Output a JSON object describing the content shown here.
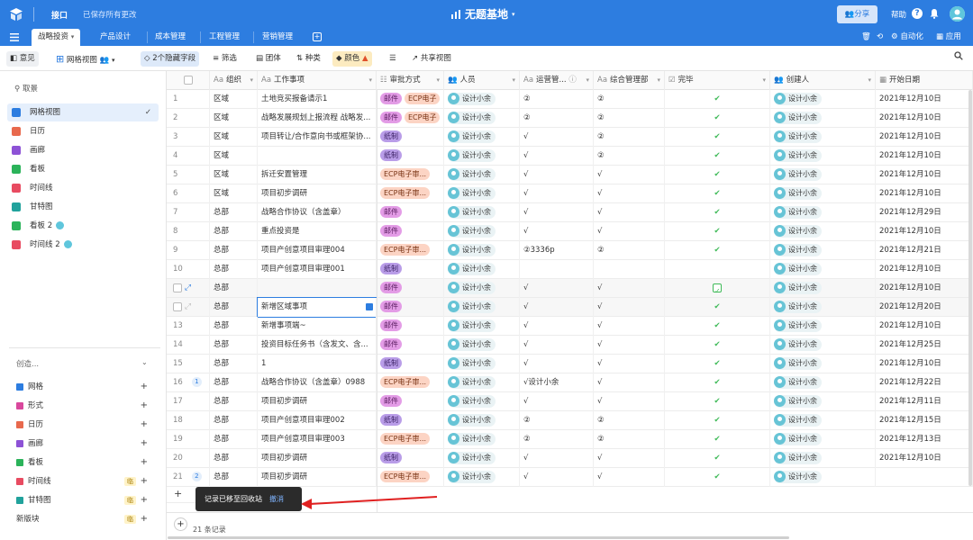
{
  "topbar": {
    "mode": "接口",
    "save_status": "已保存所有更改",
    "title": "无题基地",
    "share": "分享",
    "help": "帮助"
  },
  "tabs": [
    "战略投资",
    "产品设计",
    "成本管理",
    "工程管理",
    "营销管理"
  ],
  "tabbar_right": {
    "automation": "自动化",
    "apps": "应用"
  },
  "toolbar": {
    "opinion": "意见",
    "view": "网格视图",
    "hidden_fields": "2个隐藏字段",
    "filter": "筛选",
    "group": "团体",
    "sort": "种类",
    "color": "颜色",
    "share_view": "共享视图"
  },
  "sidebar": {
    "search": "取景",
    "views": [
      {
        "label": "网格视图",
        "color": "#2d7de0",
        "active": true
      },
      {
        "label": "日历",
        "color": "#e8694d"
      },
      {
        "label": "画廊",
        "color": "#8d52d6"
      },
      {
        "label": "看板",
        "color": "#2bb35a"
      },
      {
        "label": "时间线",
        "color": "#e84b61"
      },
      {
        "label": "甘特图",
        "color": "#21a29c"
      },
      {
        "label": "看板 2",
        "color": "#2bb35a"
      },
      {
        "label": "时间线 2",
        "color": "#e84b61"
      }
    ],
    "create_label": "创造...",
    "create_items": [
      {
        "label": "网格",
        "color": "#2d7de0"
      },
      {
        "label": "形式",
        "color": "#d9489d"
      },
      {
        "label": "日历",
        "color": "#e8694d"
      },
      {
        "label": "画廊",
        "color": "#8d52d6"
      },
      {
        "label": "看板",
        "color": "#2bb35a"
      },
      {
        "label": "时间线",
        "color": "#e84b61",
        "pro": "临"
      },
      {
        "label": "甘特图",
        "color": "#21a29c",
        "pro": "临"
      },
      {
        "label": "新版块",
        "color": "",
        "pro": "临"
      }
    ]
  },
  "columns": [
    "组织",
    "工作事项",
    "审批方式",
    "人员",
    "运营管...",
    "综合管理部",
    "完毕",
    "创建人",
    "开始日期"
  ],
  "rows": [
    {
      "n": "1",
      "org": "区域",
      "item": "土地竞买报备请示1",
      "tags": [
        "邮件",
        "ECP电子"
      ],
      "person": "设计小余",
      "op": "②",
      "mg": "②",
      "done": true,
      "creator": "设计小余",
      "date": "2021年12月10日"
    },
    {
      "n": "2",
      "org": "区域",
      "item": "战略发展规划上报流程 战略发...",
      "tags": [
        "邮件",
        "ECP电子"
      ],
      "person": "设计小余",
      "op": "②",
      "mg": "②",
      "done": true,
      "creator": "设计小余",
      "date": "2021年12月10日"
    },
    {
      "n": "3",
      "org": "区域",
      "item": "项目转让/合作意向书或框架协...",
      "tags": [
        "纸制"
      ],
      "person": "设计小余",
      "op": "√",
      "mg": "②",
      "done": true,
      "creator": "设计小余",
      "date": "2021年12月10日"
    },
    {
      "n": "4",
      "org": "区域",
      "item": "",
      "tags": [
        "纸制"
      ],
      "person": "设计小余",
      "op": "√",
      "mg": "②",
      "done": true,
      "creator": "设计小余",
      "date": "2021年12月10日"
    },
    {
      "n": "5",
      "org": "区域",
      "item": "拆迁安置管理",
      "tags": [
        "ECP电子审..."
      ],
      "person": "设计小余",
      "op": "√",
      "mg": "√",
      "done": true,
      "creator": "设计小余",
      "date": "2021年12月10日"
    },
    {
      "n": "6",
      "org": "区域",
      "item": "项目初步调研",
      "tags": [
        "ECP电子审..."
      ],
      "person": "设计小余",
      "op": "√",
      "mg": "√",
      "done": true,
      "creator": "设计小余",
      "date": "2021年12月10日"
    },
    {
      "n": "7",
      "org": "总部",
      "item": "战略合作协议（含盖章）",
      "tags": [
        "邮件"
      ],
      "person": "设计小余",
      "op": "√",
      "mg": "√",
      "done": true,
      "creator": "设计小余",
      "date": "2021年12月29日"
    },
    {
      "n": "8",
      "org": "总部",
      "item": "重点投资是",
      "tags": [
        "邮件"
      ],
      "person": "设计小余",
      "op": "√",
      "mg": "√",
      "done": true,
      "creator": "设计小余",
      "date": "2021年12月10日"
    },
    {
      "n": "9",
      "org": "总部",
      "item": "项目产创意项目审理004",
      "tags": [
        "ECP电子审..."
      ],
      "person": "设计小余",
      "op": "②3336p",
      "mg": "②",
      "done": true,
      "creator": "设计小余",
      "date": "2021年12月21日"
    },
    {
      "n": "10",
      "org": "总部",
      "item": "项目产创意项目审理001",
      "tags": [
        "纸制"
      ],
      "person": "设计小余",
      "op": "",
      "mg": "",
      "done": false,
      "creator": "设计小余",
      "date": "2021年12月10日"
    },
    {
      "n": "",
      "org": "总部",
      "item": "",
      "tags": [
        "邮件"
      ],
      "person": "设计小余",
      "op": "√",
      "mg": "√",
      "done": "box",
      "creator": "设计小余",
      "date": "2021年12月10日"
    },
    {
      "n": "",
      "org": "总部",
      "item": "新增区域事项",
      "tags": [
        "邮件"
      ],
      "person": "设计小余",
      "op": "√",
      "mg": "√",
      "done": true,
      "creator": "设计小余",
      "date": "2021年12月20日"
    },
    {
      "n": "13",
      "org": "总部",
      "item": "新增事项端~",
      "tags": [
        "邮件"
      ],
      "person": "设计小余",
      "op": "√",
      "mg": "√",
      "done": true,
      "creator": "设计小余",
      "date": "2021年12月10日"
    },
    {
      "n": "14",
      "org": "总部",
      "item": "投资目标任务书（含发文、含...",
      "tags": [
        "邮件"
      ],
      "person": "设计小余",
      "op": "√",
      "mg": "√",
      "done": true,
      "creator": "设计小余",
      "date": "2021年12月25日"
    },
    {
      "n": "15",
      "org": "总部",
      "item": "1",
      "tags": [
        "纸制"
      ],
      "person": "设计小余",
      "op": "√",
      "mg": "√",
      "done": true,
      "creator": "设计小余",
      "date": "2021年12月10日"
    },
    {
      "n": "16",
      "cmt": "1",
      "org": "总部",
      "item": "战略合作协议（含盖章）0988",
      "tags": [
        "ECP电子审..."
      ],
      "person": "设计小余",
      "op": "√设计小余",
      "mg": "√",
      "done": true,
      "creator": "设计小余",
      "date": "2021年12月22日"
    },
    {
      "n": "17",
      "org": "总部",
      "item": "项目初步调研",
      "tags": [
        "邮件"
      ],
      "person": "设计小余",
      "op": "√",
      "mg": "√",
      "done": true,
      "creator": "设计小余",
      "date": "2021年12月11日"
    },
    {
      "n": "18",
      "org": "总部",
      "item": "项目产创意项目审理002",
      "tags": [
        "纸制"
      ],
      "person": "设计小余",
      "op": "②",
      "mg": "②",
      "done": true,
      "creator": "设计小余",
      "date": "2021年12月15日"
    },
    {
      "n": "19",
      "org": "总部",
      "item": "项目产创意项目审理003",
      "tags": [
        "ECP电子审..."
      ],
      "person": "设计小余",
      "op": "②",
      "mg": "②",
      "done": true,
      "creator": "设计小余",
      "date": "2021年12月13日"
    },
    {
      "n": "20",
      "org": "总部",
      "item": "项目初步调研",
      "tags": [
        "纸制"
      ],
      "person": "设计小余",
      "op": "√",
      "mg": "√",
      "done": true,
      "creator": "设计小余",
      "date": "2021年12月10日"
    },
    {
      "n": "21",
      "cmt": "2",
      "org": "总部",
      "item": "项目初步调研",
      "tags": [
        "ECP电子审..."
      ],
      "person": "设计小余",
      "op": "√",
      "mg": "√",
      "done": true,
      "creator": "设计小余",
      "date": ""
    }
  ],
  "footer": {
    "count": "21 条记录"
  },
  "toast": {
    "message": "记录已移至回收站",
    "undo": "撤消"
  },
  "colors": {
    "primary": "#2d7de0",
    "check": "#3fba58",
    "arrow": "#e02020"
  }
}
